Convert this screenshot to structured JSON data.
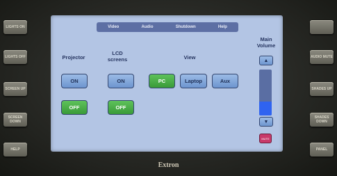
{
  "tabs": [
    "Video",
    "Audio",
    "Shutdown",
    "Help"
  ],
  "projector": {
    "label": "Projector",
    "on": "ON",
    "off": "OFF"
  },
  "lcd": {
    "label": "LCD screens",
    "on": "ON",
    "off": "OFF"
  },
  "view": {
    "label": "View",
    "options": [
      "PC",
      "Laptop",
      "Aux"
    ],
    "selected": "PC"
  },
  "volume": {
    "label": "Main Volume",
    "level_fraction": 0.3,
    "mute": "MUTE",
    "fill_color": "#2f63f0"
  },
  "colors": {
    "selected": "#3a9b38",
    "button": "#6d95cf",
    "tabbar": "#5d6fa4",
    "screen": "#b3c5e4"
  },
  "left_buttons": [
    "LIGHTS ON",
    "LIGHTS OFF",
    "SCREEN UP",
    "SCREEN DOWN",
    "HELP"
  ],
  "right_buttons": [
    "",
    "AUDIO MUTE",
    "SHADES UP",
    "SHADES DOWN",
    "PANEL"
  ],
  "brand": "Extron"
}
